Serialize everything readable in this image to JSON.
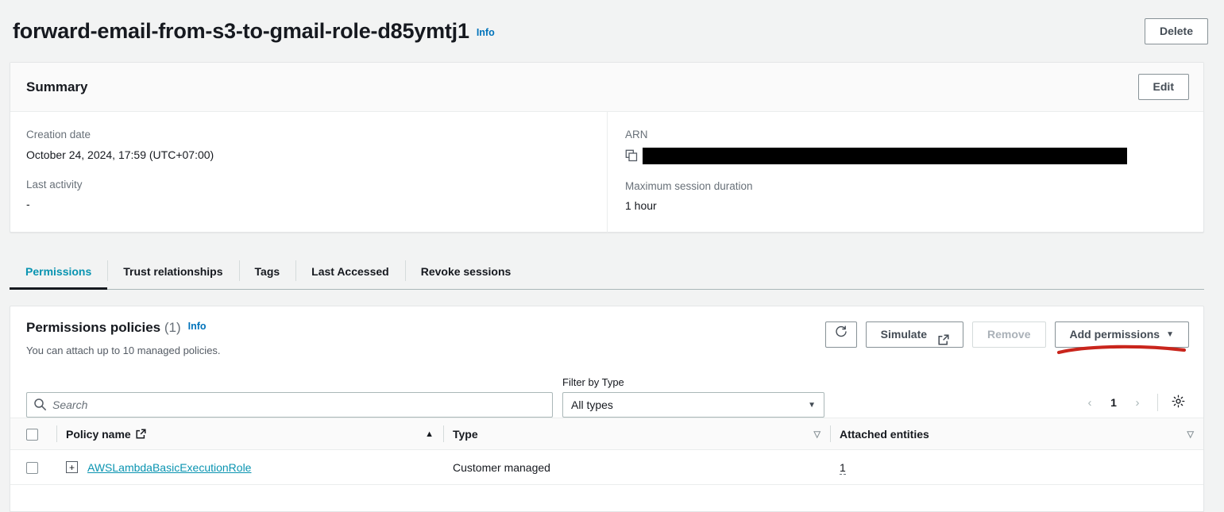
{
  "page": {
    "title": "forward-email-from-s3-to-gmail-role-d85ymtj1",
    "info_label": "Info",
    "delete_label": "Delete"
  },
  "summary": {
    "title": "Summary",
    "edit_label": "Edit",
    "fields": {
      "creation_date_label": "Creation date",
      "creation_date_value": "October 24, 2024, 17:59 (UTC+07:00)",
      "last_activity_label": "Last activity",
      "last_activity_value": "-",
      "arn_label": "ARN",
      "arn_value": "",
      "max_session_label": "Maximum session duration",
      "max_session_value": "1 hour"
    },
    "icons": {
      "copy": "copy-icon"
    }
  },
  "tabs": [
    {
      "label": "Permissions",
      "active": true
    },
    {
      "label": "Trust relationships",
      "active": false
    },
    {
      "label": "Tags",
      "active": false
    },
    {
      "label": "Last Accessed",
      "active": false
    },
    {
      "label": "Revoke sessions",
      "active": false
    }
  ],
  "permissions": {
    "heading": "Permissions policies",
    "count": "(1)",
    "info_label": "Info",
    "description": "You can attach up to 10 managed policies.",
    "actions": {
      "refresh": "refresh-icon",
      "simulate_label": "Simulate",
      "simulate_icon": "external-link-icon",
      "remove_label": "Remove",
      "remove_disabled": true,
      "add_permissions_label": "Add permissions",
      "add_permissions_caret": "▼"
    },
    "filters": {
      "search_placeholder": "Search",
      "search_value": "",
      "search_icon": "search-icon",
      "type_label": "Filter by Type",
      "type_value": "All types",
      "type_caret": "▼"
    },
    "pagination": {
      "prev": "‹",
      "page": "1",
      "next": "›",
      "settings_icon": "gear-icon"
    },
    "table": {
      "columns": [
        {
          "label": "Policy name",
          "sort": "asc",
          "sort_glyph": "▲",
          "external_link": true
        },
        {
          "label": "Type",
          "sort": "none",
          "sort_glyph": "▽"
        },
        {
          "label": "Attached entities",
          "sort": "none",
          "sort_glyph": "▽"
        }
      ],
      "rows": [
        {
          "policy_name": "AWSLambdaBasicExecutionRole",
          "type": "Customer managed",
          "attached_entities": "1",
          "expand_glyph": "+"
        }
      ]
    }
  },
  "annotation": {
    "color": "#c9251c",
    "target": "add-permissions-button"
  },
  "colors": {
    "page_background": "#f2f3f3",
    "card_background": "#ffffff",
    "link": "#0a94b1",
    "info_link": "#0073bb",
    "text": "#16191f",
    "muted_text": "#687078",
    "border": "#eaeded",
    "annotation_red": "#c9251c"
  }
}
